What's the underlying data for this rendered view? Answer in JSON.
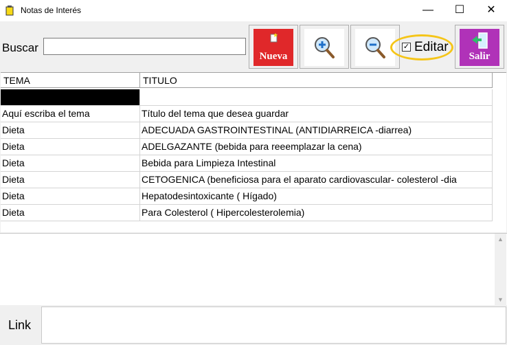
{
  "window": {
    "title": "Notas de Interés",
    "minimize_glyph": "—",
    "maximize_glyph": "☐",
    "close_glyph": "✕"
  },
  "toolbar": {
    "search_label": "Buscar",
    "search_value": "",
    "new_label": "Nueva",
    "zoom_in_icon": "zoom-in-icon",
    "zoom_out_icon": "zoom-out-icon",
    "edit_label": "Editar",
    "edit_checked": true,
    "exit_label": "Salir"
  },
  "grid": {
    "columns": [
      "TEMA",
      "TITULO"
    ],
    "rows": [
      [
        "",
        ""
      ],
      [
        "Aquí escriba el tema",
        "Título del tema que desea guardar"
      ],
      [
        "Dieta",
        "ADECUADA GASTROINTESTINAL (ANTIDIARREICA -diarrea)"
      ],
      [
        "Dieta",
        "ADELGAZANTE (bebida para reeemplazar la cena)"
      ],
      [
        "Dieta",
        "Bebida para Limpieza Intestinal"
      ],
      [
        "Dieta",
        "CETOGENICA (beneficiosa para el aparato cardiovascular- colesterol -dia"
      ],
      [
        "Dieta",
        "Hepatodesintoxicante ( Hígado)"
      ],
      [
        "Dieta",
        "Para Colesterol ( Hipercolesterolemia)"
      ]
    ]
  },
  "notes": {
    "value": ""
  },
  "link": {
    "label": "Link",
    "value": ""
  },
  "colors": {
    "accent_red": "#e0282a",
    "accent_purple": "#b032b8",
    "highlight_yellow": "#f5c518"
  }
}
